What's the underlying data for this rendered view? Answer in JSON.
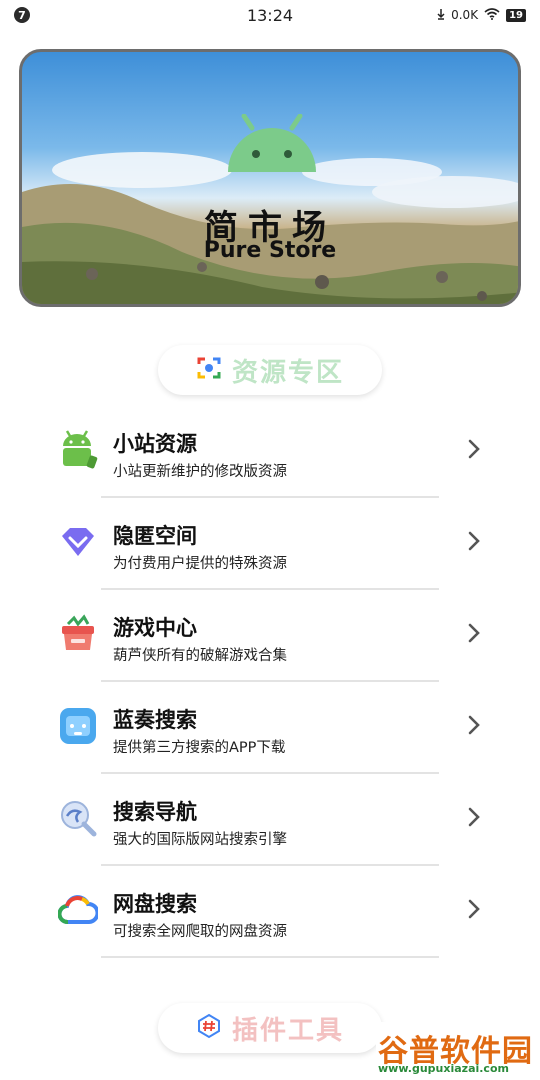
{
  "status_bar": {
    "notification_badge": "7",
    "time": "13:24",
    "net_speed": "0.0K",
    "battery": "19",
    "icons": [
      "download-speed-icon",
      "wifi-icon",
      "battery-icon"
    ]
  },
  "banner": {
    "title": "简市场",
    "subtitle": "Pure Store",
    "logo_color": "#7ccb8a"
  },
  "resource_section": {
    "label": "资源专区",
    "icon": "lens-icon"
  },
  "items": [
    {
      "title": "小站资源",
      "subtitle": "小站更新维护的修改版资源",
      "icon": "android-icon"
    },
    {
      "title": "隐匿空间",
      "subtitle": "为付费用户提供的特殊资源",
      "icon": "diamond-icon"
    },
    {
      "title": "游戏中心",
      "subtitle": "葫芦侠所有的破解游戏合集",
      "icon": "game-box-icon"
    },
    {
      "title": "蓝奏搜索",
      "subtitle": "提供第三方搜索的APP下载",
      "icon": "lanzou-icon"
    },
    {
      "title": "搜索导航",
      "subtitle": "强大的国际版网站搜索引擎",
      "icon": "search-nav-icon"
    },
    {
      "title": "网盘搜索",
      "subtitle": "可搜索全网爬取的网盘资源",
      "icon": "cloud-icon"
    }
  ],
  "plugin_section": {
    "label": "插件工具",
    "icon": "hash-icon"
  },
  "watermark": {
    "main": "谷普软件园",
    "url": "www.gupuxiazai.com"
  },
  "colors": {
    "accent_green": "#7ccb8a",
    "pill_text": "#bfe5c6",
    "divider": "#e3e3e3"
  }
}
